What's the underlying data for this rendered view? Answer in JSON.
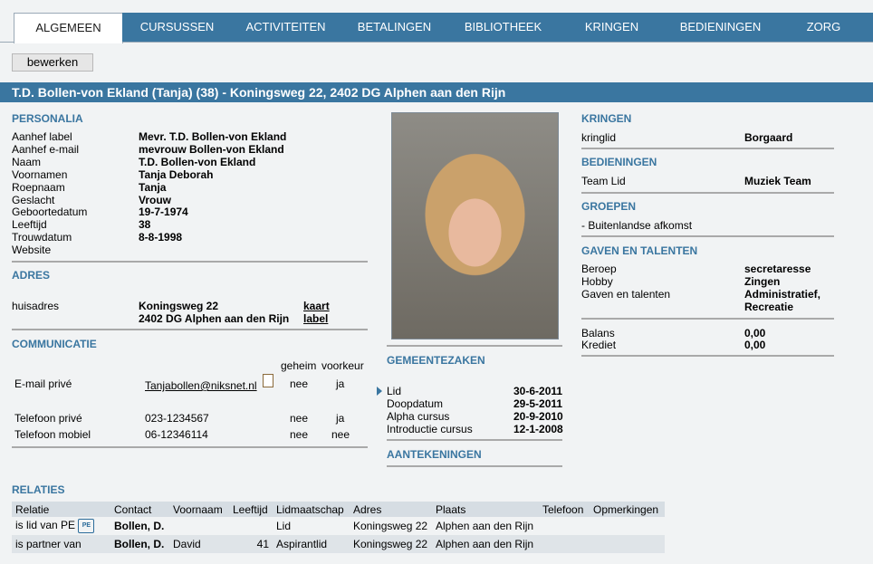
{
  "tabs": [
    {
      "label": "ALGEMEEN",
      "active": true
    },
    {
      "label": "CURSUSSEN"
    },
    {
      "label": "ACTIVITEITEN"
    },
    {
      "label": "BETALINGEN"
    },
    {
      "label": "BIBLIOTHEEK"
    },
    {
      "label": "KRINGEN"
    },
    {
      "label": "BEDIENINGEN"
    },
    {
      "label": "ZORG"
    }
  ],
  "edit_button": "bewerken",
  "title": "T.D. Bollen-von Ekland (Tanja) (38) - Koningsweg 22, 2402 DG Alphen aan den Rijn",
  "personalia": {
    "header": "PERSONALIA",
    "rows": [
      {
        "label": "Aanhef label",
        "value": "Mevr. T.D. Bollen-von Ekland"
      },
      {
        "label": "Aanhef e-mail",
        "value": "mevrouw Bollen-von Ekland"
      },
      {
        "label": "Naam",
        "value": "T.D. Bollen-von Ekland"
      },
      {
        "label": "Voornamen",
        "value": "Tanja Deborah"
      },
      {
        "label": "Roepnaam",
        "value": "Tanja"
      },
      {
        "label": "Geslacht",
        "value": "Vrouw"
      },
      {
        "label": "Geboortedatum",
        "value": "19-7-1974"
      },
      {
        "label": "Leeftijd",
        "value": "38"
      },
      {
        "label": "Trouwdatum",
        "value": "8-8-1998"
      },
      {
        "label": "Website",
        "value": ""
      }
    ]
  },
  "adres": {
    "header": "ADRES",
    "label": "huisadres",
    "line1": "Koningsweg 22",
    "line2": "2402 DG Alphen aan den Rijn",
    "link1": "kaart",
    "link2": "label"
  },
  "communicatie": {
    "header": "COMMUNICATIE",
    "col_geheim": "geheim",
    "col_voorkeur": "voorkeur",
    "rows": [
      {
        "label": "E-mail privé",
        "value": "Tanjabollen@niksnet.nl",
        "geheim": "nee",
        "voorkeur": "ja"
      },
      {
        "label": "Telefoon privé",
        "value": "023-1234567",
        "geheim": "nee",
        "voorkeur": "ja"
      },
      {
        "label": "Telefoon mobiel",
        "value": "06-12346114",
        "geheim": "nee",
        "voorkeur": "nee"
      }
    ]
  },
  "gemeentezaken": {
    "header": "GEMEENTEZAKEN",
    "rows": [
      {
        "label": "Lid",
        "value": "30-6-2011"
      },
      {
        "label": "Doopdatum",
        "value": "29-5-2011"
      },
      {
        "label": "Alpha cursus",
        "value": "20-9-2010"
      },
      {
        "label": "Introductie cursus",
        "value": "12-1-2008"
      }
    ]
  },
  "aantekeningen_header": "AANTEKENINGEN",
  "kringen": {
    "header": "KRINGEN",
    "label": "kringlid",
    "value": "Borgaard"
  },
  "bedieningen": {
    "header": "BEDIENINGEN",
    "label": "Team Lid",
    "value": "Muziek Team"
  },
  "groepen": {
    "header": "GROEPEN",
    "item": "- Buitenlandse afkomst"
  },
  "gaven": {
    "header": "GAVEN EN TALENTEN",
    "rows": [
      {
        "label": "Beroep",
        "value": "secretaresse"
      },
      {
        "label": "Hobby",
        "value": "Zingen"
      },
      {
        "label": "Gaven en talenten",
        "value": "Administratief,"
      },
      {
        "label": "",
        "value": "Recreatie"
      }
    ]
  },
  "financieel": {
    "rows": [
      {
        "label": "Balans",
        "value": "0,00"
      },
      {
        "label": "Krediet",
        "value": "0,00"
      }
    ]
  },
  "relaties": {
    "header": "RELATIES",
    "columns": [
      "Relatie",
      "Contact",
      "Voornaam",
      "Leeftijd",
      "Lidmaatschap",
      "Adres",
      "Plaats",
      "Telefoon",
      "Opmerkingen"
    ],
    "pe_icon": "PE",
    "rows": [
      {
        "relatie": "is lid van PE",
        "contact": "Bollen, D.",
        "voornaam": "",
        "leeftijd": "",
        "lidmaatschap": "Lid",
        "adres": "Koningsweg 22",
        "plaats": "Alphen aan den Rijn",
        "telefoon": "",
        "opmerkingen": ""
      },
      {
        "relatie": "is partner van",
        "contact": "Bollen, D.",
        "voornaam": "David",
        "leeftijd": "41",
        "lidmaatschap": "Aspirantlid",
        "adres": "Koningsweg 22",
        "plaats": "Alphen aan den Rijn",
        "telefoon": "",
        "opmerkingen": ""
      }
    ]
  }
}
